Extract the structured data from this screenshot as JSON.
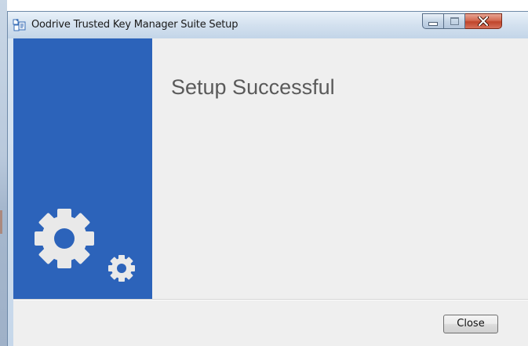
{
  "window": {
    "title": "Oodrive Trusted Key Manager Suite Setup",
    "app_icon": "installer-icon",
    "controls": {
      "minimize_icon": "minimize-icon",
      "maximize_icon": "maximize-icon",
      "close_icon": "close-icon"
    }
  },
  "side_panel": {
    "icon": "gears-icon",
    "color": "#2c63ba"
  },
  "content": {
    "heading": "Setup Successful"
  },
  "footer": {
    "close_label": "Close"
  },
  "colors": {
    "accent": "#2c63ba",
    "close_control": "#c0452b",
    "heading_text": "#5a5a5a",
    "dialog_background": "#efefef"
  }
}
